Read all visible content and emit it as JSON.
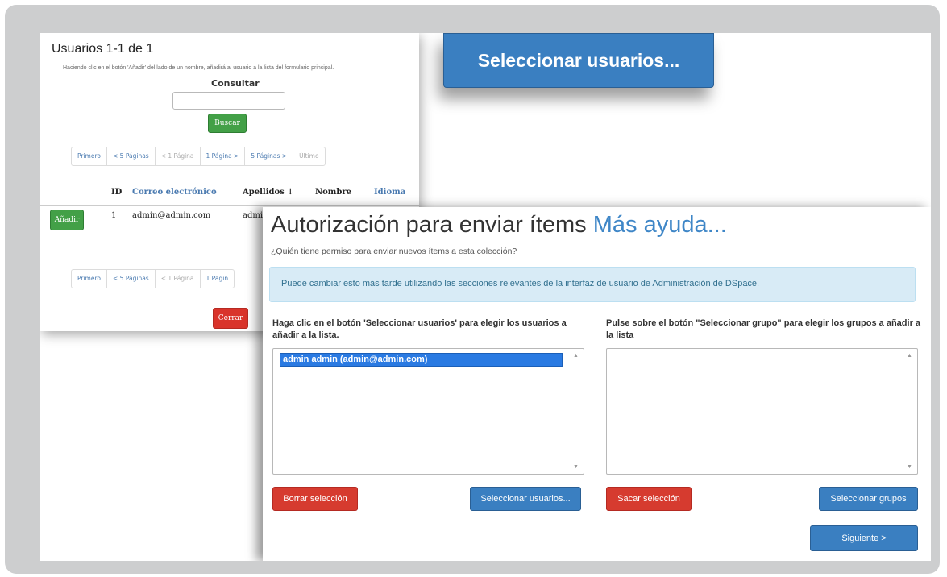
{
  "users_popup": {
    "title": "Usuarios 1-1 de 1",
    "help_text": "Haciendo clic en el botón 'Añadir' del lado de un nombre, añadirá al usuario a la lista del formulario principal.",
    "search": {
      "label": "Consultar",
      "value": "",
      "button": "Buscar"
    },
    "pagination": [
      "Primero",
      "< 5 Páginas",
      "< 1 Página",
      "1 Página >",
      "5 Páginas >",
      "Último"
    ],
    "pagination_bottom": [
      "Primero",
      "< 5 Páginas",
      "< 1 Página",
      "1 Pagin"
    ],
    "table": {
      "headers": {
        "id": "ID",
        "email": "Correo electrónico",
        "lastname": "Apellidos ↓",
        "firstname": "Nombre",
        "language": "Idioma"
      },
      "rows": [
        {
          "action": "Añadir",
          "id": "1",
          "email": "admin@admin.com",
          "lastname": "admin"
        }
      ]
    },
    "close_button": "Cerrar"
  },
  "zoom_button": {
    "label": "Seleccionar usuarios..."
  },
  "auth_panel": {
    "title": "Autorización para enviar ítems",
    "help_link": "Más ayuda...",
    "subtitle": "¿Quién tiene permiso para enviar nuevos ítems a esta colección?",
    "info": "Puede cambiar esto más tarde utilizando las secciones relevantes de la interfaz de usuario de Administración de DSpace.",
    "users_column": {
      "instruction": "Haga clic en el botón 'Seleccionar usuarios' para elegir los usuarios a añadir a la lista.",
      "items": [
        "admin admin (admin@admin.com)"
      ],
      "clear_button": "Borrar selección",
      "select_button": "Seleccionar usuarios..."
    },
    "groups_column": {
      "instruction": "Pulse sobre el botón \"Seleccionar grupo\" para elegir los grupos a añadir a la lista",
      "items": [],
      "clear_button": "Sacar selección",
      "select_button": "Seleccionar grupos"
    },
    "next_button": "Siguiente >"
  },
  "colors": {
    "primary_blue": "#3a7fc1",
    "danger_red": "#d63b2f",
    "success_green": "#43a047",
    "info_bg": "#d8ebf6",
    "link_blue": "#3e86c7"
  }
}
